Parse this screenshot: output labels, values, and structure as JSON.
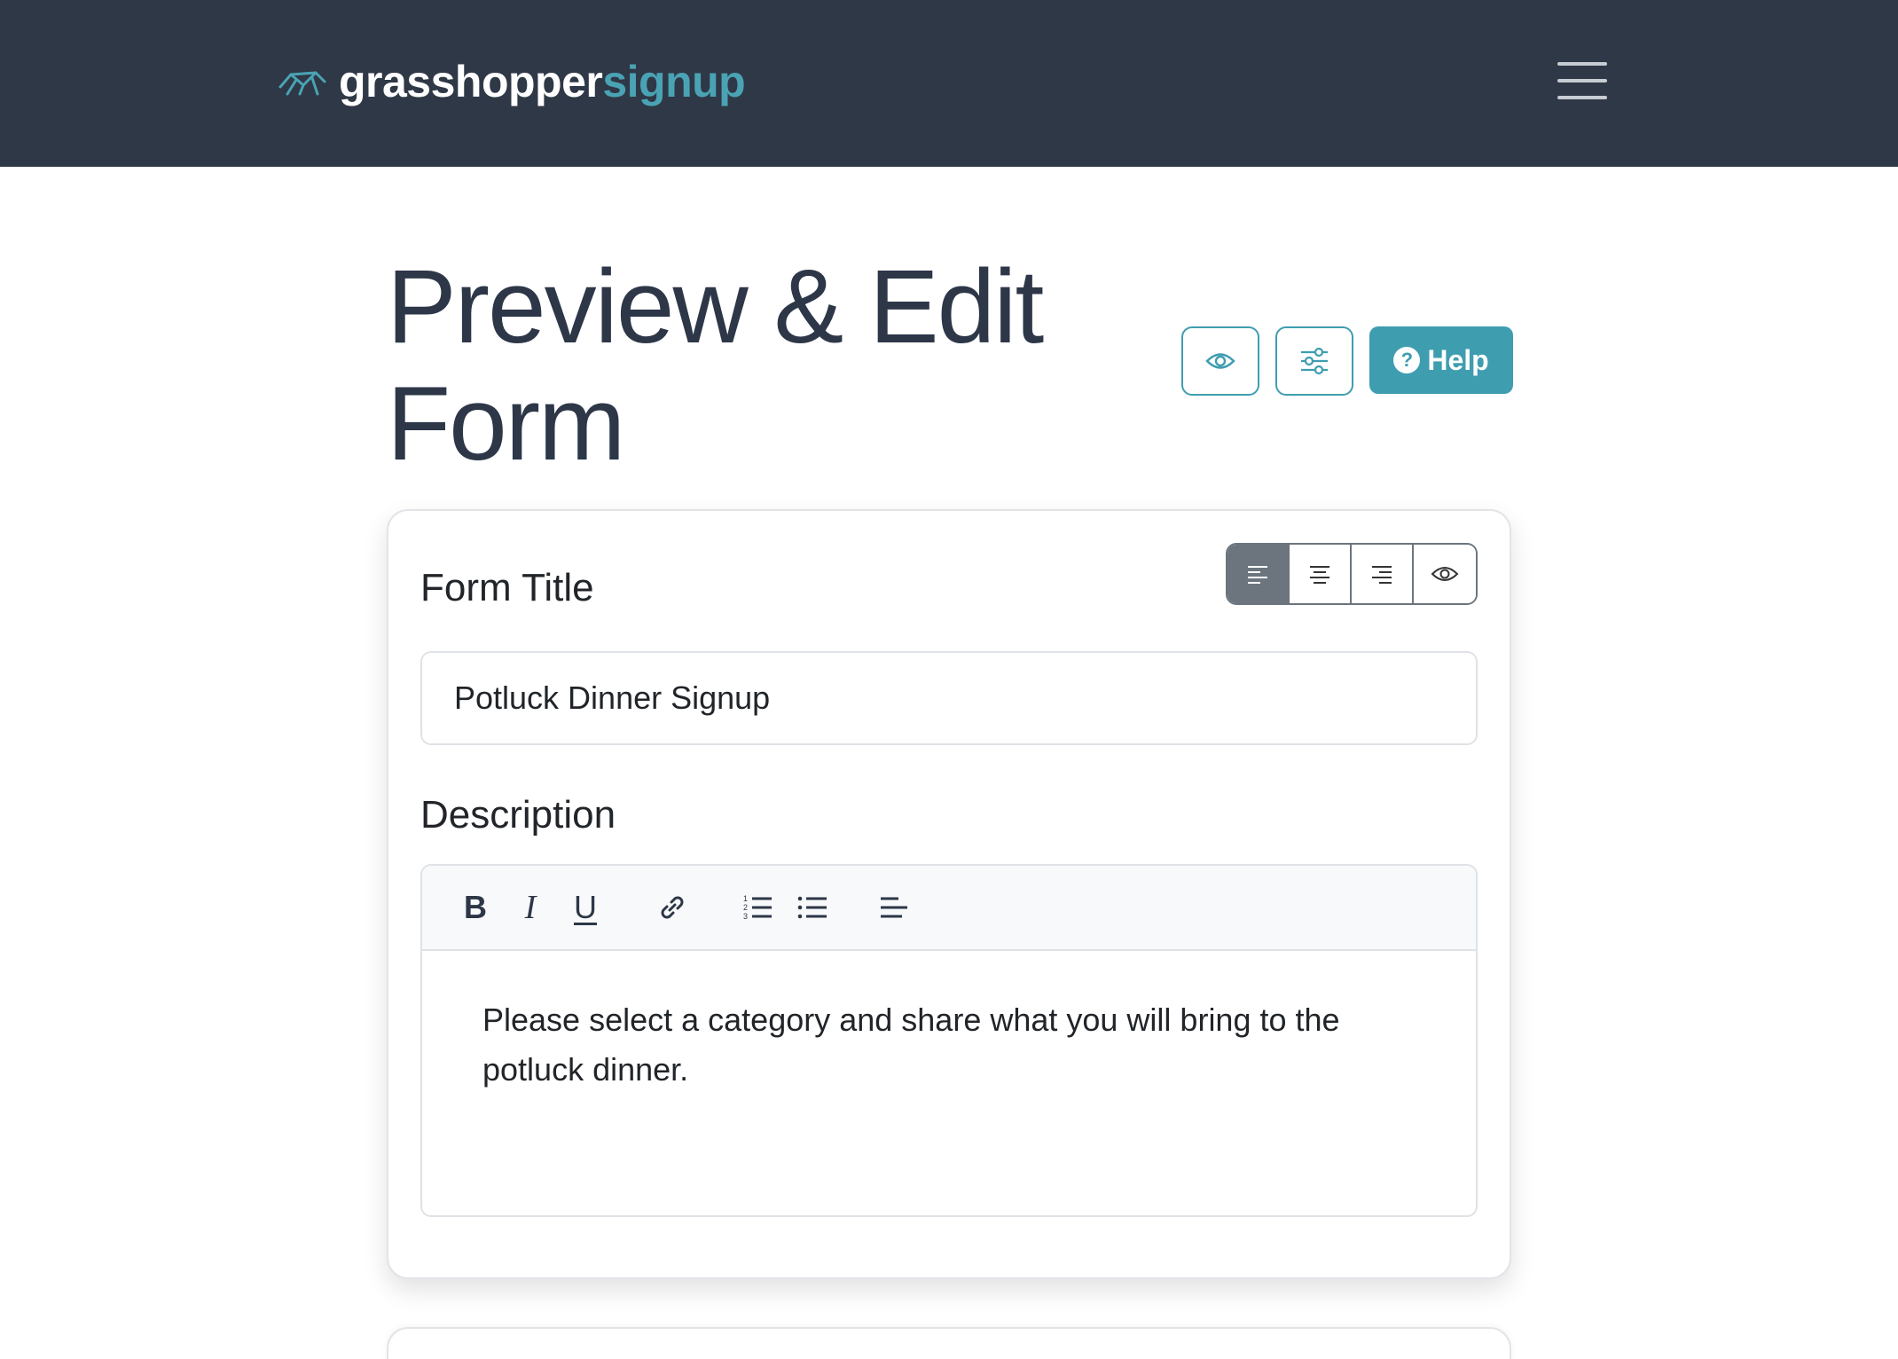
{
  "header": {
    "brand_part1": "grasshopper",
    "brand_part2": "signup",
    "brand_color": "#4aa3b4",
    "bg_color": "#2f3846",
    "menu_icon": "hamburger-menu-icon"
  },
  "page": {
    "title": "Preview & Edit Form",
    "help_label": "Help",
    "actions": [
      "eye-icon",
      "sliders-icon",
      "question-circle-icon"
    ]
  },
  "form": {
    "title_label": "Form Title",
    "title_value": "Potluck Dinner Signup",
    "alignment_options": [
      "align-left-icon",
      "align-center-icon",
      "align-right-icon",
      "eye-icon"
    ],
    "alignment_selected": "align-left",
    "description_label": "Description",
    "description_text": "Please select a category and share what you will bring to the potluck dinner.",
    "toolbar": {
      "bold": "B",
      "italic": "I",
      "underline": "U",
      "icons": [
        "link-icon",
        "ordered-list-icon",
        "bullet-list-icon",
        "align-icon"
      ]
    }
  },
  "colors": {
    "accent": "#3f9db0",
    "text": "#2d3748"
  }
}
